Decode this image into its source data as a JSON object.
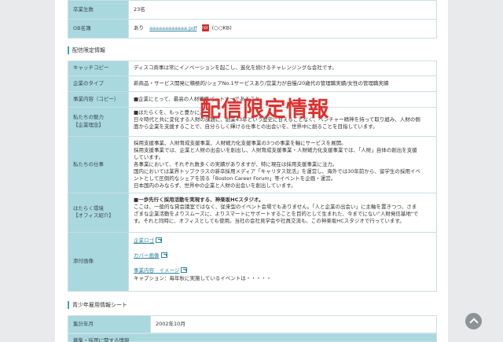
{
  "top_rows": [
    {
      "label": "卒業生数",
      "value": "23名"
    },
    {
      "label": "OB名簿",
      "prefix": "あり",
      "link": "aaaaaaaaaaaa.pdf",
      "pdf_icon": "pdf-file-icon",
      "size": "(○○KB)"
    }
  ],
  "section1_title": "配信限定情報",
  "watermark": "配信限定情報",
  "rows": {
    "catch_label": "キャッチコピー",
    "catch_value": "ディスコ商事は常にイノベーションを起こし、進化を続けるチャレンジングな会社です。",
    "type_label": "企業のタイプ",
    "type_value": "新商品・サービス開発に積極的/シェアNo.1サービスあり/営業力が自慢/20歳代の管理職実績/女性の管理職実績",
    "business_label": "事業内容（コピー）",
    "business_value": "■企業にとって、最高の人材戦略パートナーであること。",
    "appeal_label1": "私たちの魅力",
    "appeal_label2": "【企業理念】",
    "appeal_lines": [
      "■はたらくを、もっと豊かに。",
      "日々時代と共に変化する人財の課題に、創業43年という歴史に甘えることなく、ベンチャー精神を持って取り組み、人財の側",
      "面から企業を支援することで、自分らしく輝ける仕事との出会いを、世界中に創ることを目指しています。"
    ],
    "work_label": "私たちの仕事",
    "work_lines": [
      "採用支援事業、人財育成支援事業、人財戦力化支援事業の3つの事業を軸にサービスを展開。",
      "採用支援事業では、企業と人財の出会いを創出し、人財育成支援事業・人財戦力化支援事業では、「人財」自体の創出を支援",
      "しています。",
      "各事業において、それぞれ数多くの実績がありますが、特に現在は採用支援事業に注力。",
      "国内においては業界トップクラスの新卒採用メディア「キャリタス就活」を運営し、海外では30年前から、留学生の採用イベ",
      "ントとして圧倒的なシェアを誇る「Boston Career Forum」等イベントを企画・運営。",
      "日本国内のみならず、世界中の企業と人財の出会いを創出しています。"
    ],
    "env_label1": "はたらく環境",
    "env_label2": "【オフィス紹介】",
    "env_lines": [
      "■一歩先行く採用活動を実現する、神楽坂HCスタジオ。",
      "ここは、一般的な貸会議室ではなく、従来型のイベント会場でもありません。「人と企業の出会い」に主軸を置きつつ、さま",
      "ざまな企業活動をよりスムーズに、よりスマートにサポートすることを目的として生まれた、今までにない\"人財発信基地\"で",
      "す。それと同時に、オフィスとしても使用。当社の会社見学会や社員交流も、この神楽坂HCスタジオで行っています。"
    ],
    "attach_label": "添付画像",
    "attach_links": [
      "企業ロゴ",
      "カバー画像",
      "事業内容　イメージ"
    ],
    "attach_caption": "キャプション：毎年秋に実施しているイベントは・・・・・"
  },
  "section2_title": "青少年雇用情報シート",
  "founded_label": "集計年月",
  "founded_value": "2002年10月",
  "cut_label": "募集・採用に関する情報",
  "scroll_top_icon": "chevron-up-icon"
}
